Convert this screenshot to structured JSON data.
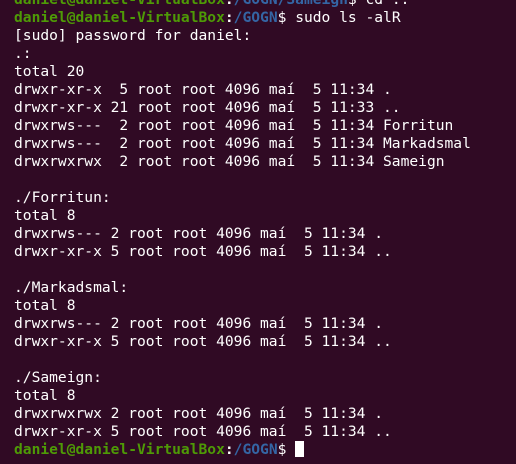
{
  "colors": {
    "background": "#300a24",
    "text": "#ffffff",
    "prompt_user": "#4e9a06",
    "prompt_path": "#3465a4"
  },
  "top_prompt": {
    "user_host": "daniel@daniel-VirtualBox",
    "sep": ":",
    "path": "/GOGN/Sameign",
    "dollar": "$",
    "command": " cd .."
  },
  "main_prompt": {
    "user_host": "daniel@daniel-VirtualBox",
    "sep": ":",
    "path": "/GOGN",
    "dollar": "$",
    "command": " sudo ls -alR"
  },
  "output": [
    "[sudo] password for daniel:",
    ".:",
    "total 20",
    "drwxr-xr-x  5 root root 4096 maí  5 11:34 .",
    "drwxr-xr-x 21 root root 4096 maí  5 11:33 ..",
    "drwxrws---  2 root root 4096 maí  5 11:34 Forritun",
    "drwxrws---  2 root root 4096 maí  5 11:34 Markadsmal",
    "drwxrwxrwx  2 root root 4096 maí  5 11:34 Sameign",
    "",
    "./Forritun:",
    "total 8",
    "drwxrws--- 2 root root 4096 maí  5 11:34 .",
    "drwxr-xr-x 5 root root 4096 maí  5 11:34 ..",
    "",
    "./Markadsmal:",
    "total 8",
    "drwxrws--- 2 root root 4096 maí  5 11:34 .",
    "drwxr-xr-x 5 root root 4096 maí  5 11:34 ..",
    "",
    "./Sameign:",
    "total 8",
    "drwxrwxrwx 2 root root 4096 maí  5 11:34 .",
    "drwxr-xr-x 5 root root 4096 maí  5 11:34 .."
  ],
  "final_prompt": {
    "user_host": "daniel@daniel-VirtualBox",
    "sep": ":",
    "path": "/GOGN",
    "dollar": "$"
  }
}
